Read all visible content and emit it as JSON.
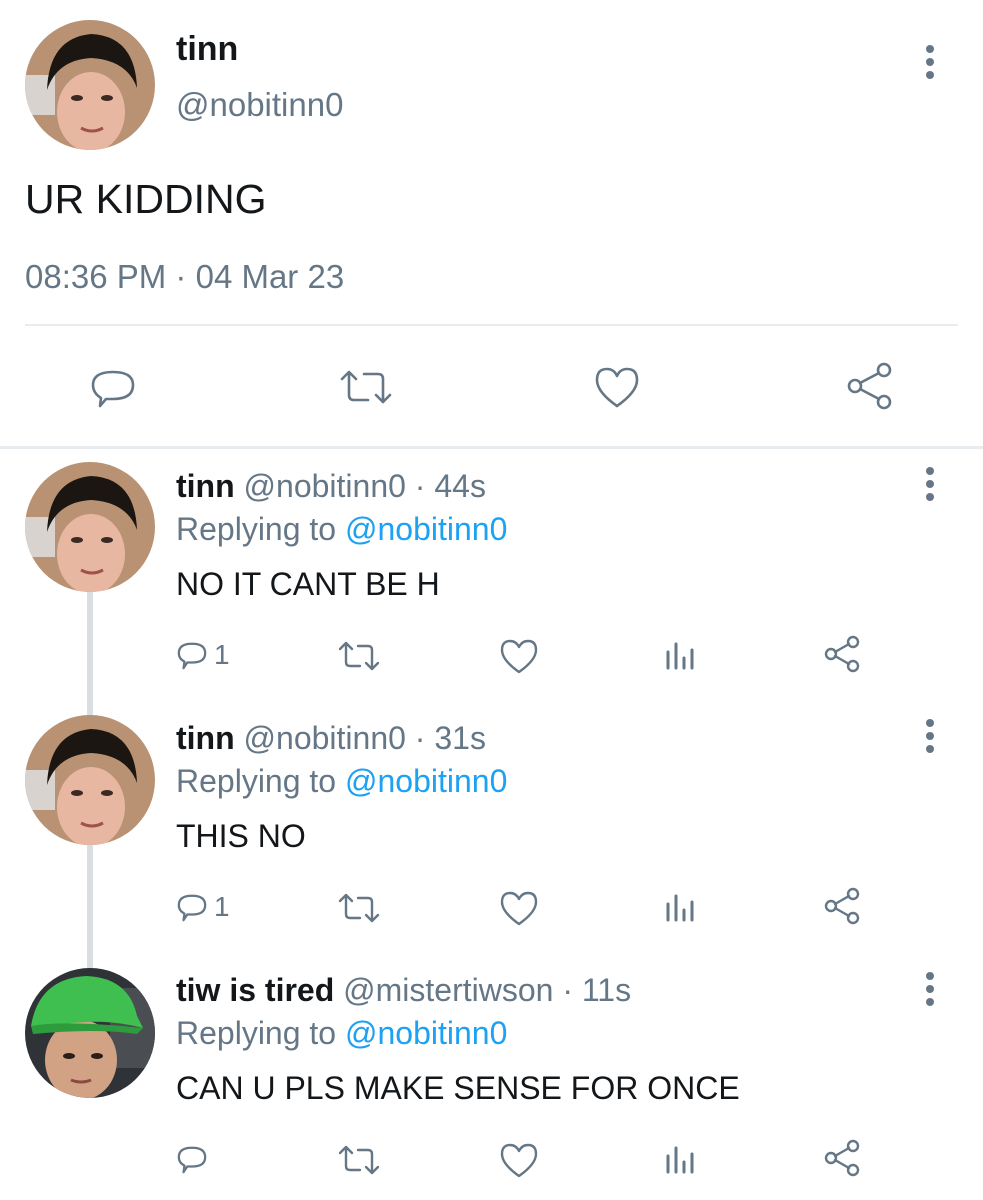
{
  "main_tweet": {
    "display_name": "tinn",
    "handle": "@nobitinn0",
    "text": "UR KIDDING",
    "time": "08:36 PM",
    "separator": "·",
    "date": "04 Mar 23",
    "actions": {
      "reply_icon": "speech-bubble-icon",
      "retweet_icon": "retweet-icon",
      "like_icon": "heart-icon",
      "share_icon": "share-icon"
    }
  },
  "replies": [
    {
      "display_name": "tinn",
      "handle": "@nobitinn0",
      "time_meta": "· 44s",
      "replying_prefix": "Replying to",
      "replying_to": "@nobitinn0",
      "text": "NO IT CANT BE H",
      "reply_count": "1"
    },
    {
      "display_name": "tinn",
      "handle": "@nobitinn0",
      "time_meta": "· 31s",
      "replying_prefix": "Replying to",
      "replying_to": "@nobitinn0",
      "text": "THIS NO",
      "reply_count": "1"
    },
    {
      "display_name": "tiw is tired",
      "handle": "@mistertiwson",
      "time_meta": "· 11s",
      "replying_prefix": "Replying to",
      "replying_to": "@nobitinn0",
      "text": "CAN U PLS MAKE SENSE FOR ONCE",
      "reply_count": ""
    }
  ],
  "colors": {
    "text": "#14171a",
    "muted": "#657786",
    "link": "#1da1f2",
    "divider": "#e6ecf0"
  }
}
